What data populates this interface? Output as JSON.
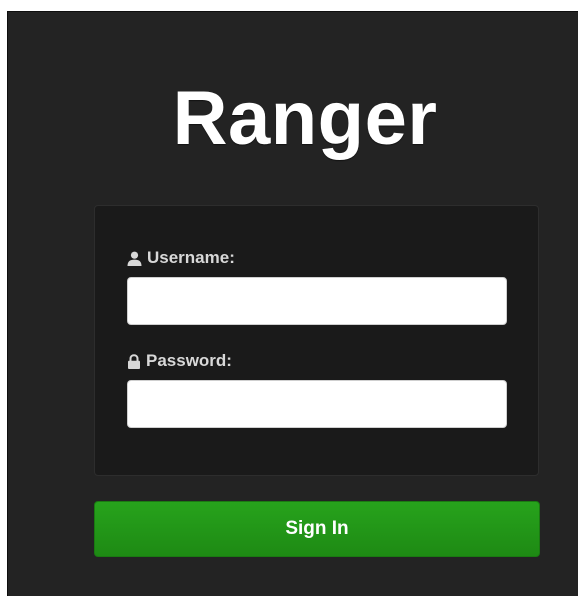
{
  "brand": {
    "title": "Ranger"
  },
  "login_form": {
    "username": {
      "label": "Username:",
      "value": "",
      "icon": "user-icon"
    },
    "password": {
      "label": "Password:",
      "value": "",
      "icon": "lock-icon"
    },
    "submit_label": "Sign In"
  },
  "colors": {
    "background": "#232323",
    "form_box": "#1a1a1a",
    "button": "#22991a",
    "title": "#ffffff",
    "label": "#d8d8d8"
  }
}
